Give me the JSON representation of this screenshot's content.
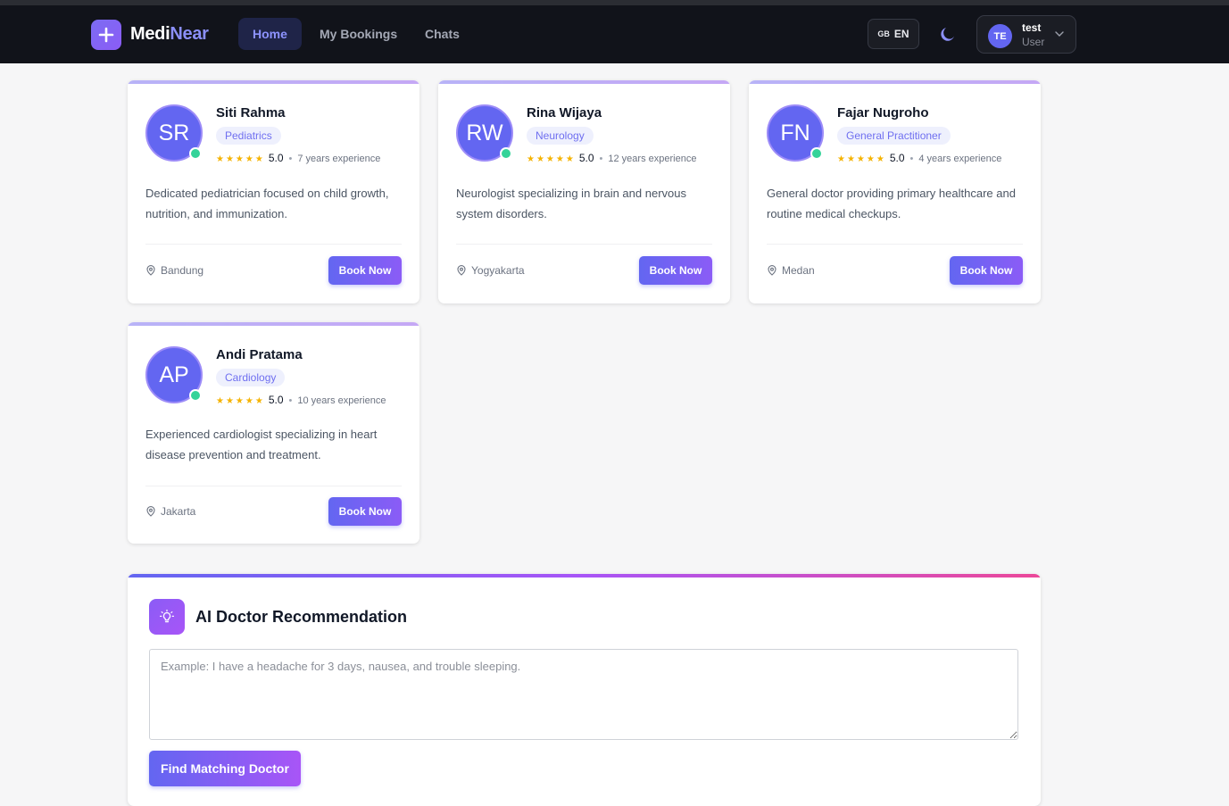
{
  "app": {
    "logo_main": "Medi",
    "logo_accent": "Near"
  },
  "nav": {
    "links": [
      {
        "label": "Home",
        "active": true
      },
      {
        "label": "My Bookings",
        "active": false
      },
      {
        "label": "Chats",
        "active": false
      }
    ],
    "lang_flag": "GB",
    "lang_code": "EN",
    "user": {
      "initials": "TE",
      "name": "test",
      "role": "User"
    }
  },
  "doctors": [
    {
      "initials": "SR",
      "name": "Siti Rahma",
      "specialty": "Pediatrics",
      "stars": "★★★★★",
      "rating": "5.0",
      "experience": "7 years experience",
      "description": "Dedicated pediatrician focused on child growth, nutrition, and immunization.",
      "location": "Bandung",
      "book_label": "Book Now"
    },
    {
      "initials": "RW",
      "name": "Rina Wijaya",
      "specialty": "Neurology",
      "stars": "★★★★★",
      "rating": "5.0",
      "experience": "12 years experience",
      "description": "Neurologist specializing in brain and nervous system disorders.",
      "location": "Yogyakarta",
      "book_label": "Book Now"
    },
    {
      "initials": "FN",
      "name": "Fajar Nugroho",
      "specialty": "General Practitioner",
      "stars": "★★★★★",
      "rating": "5.0",
      "experience": "4 years experience",
      "description": "General doctor providing primary healthcare and routine medical checkups.",
      "location": "Medan",
      "book_label": "Book Now"
    },
    {
      "initials": "AP",
      "name": "Andi Pratama",
      "specialty": "Cardiology",
      "stars": "★★★★★",
      "rating": "5.0",
      "experience": "10 years experience",
      "description": "Experienced cardiologist specializing in heart disease prevention and treatment.",
      "location": "Jakarta",
      "book_label": "Book Now"
    }
  ],
  "ai": {
    "title": "AI Doctor Recommendation",
    "placeholder": "Example: I have a headache for 3 days, nausea, and trouble sleeping.",
    "button": "Find Matching Doctor"
  }
}
